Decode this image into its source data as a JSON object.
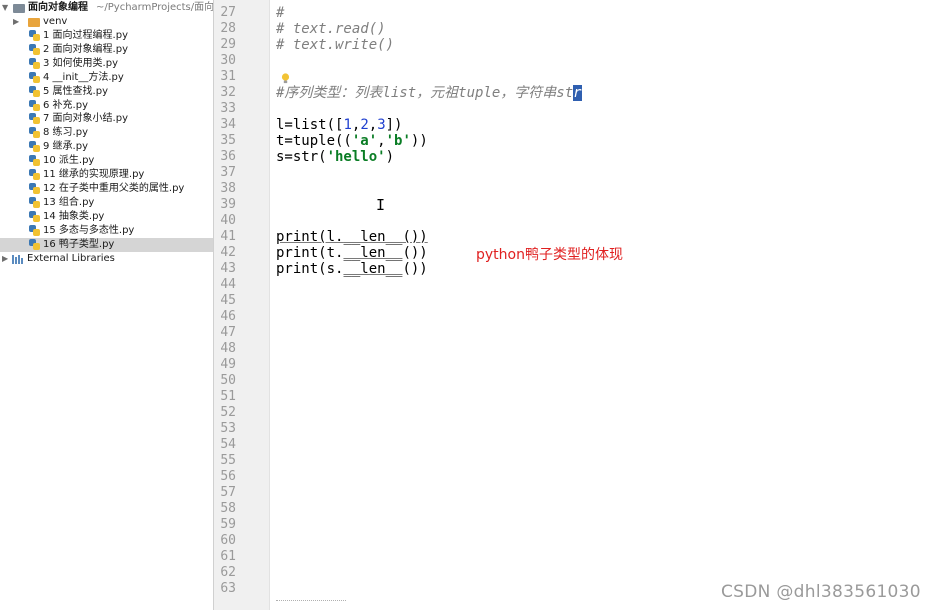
{
  "project": {
    "root_label": "面向对象编程",
    "root_path": "~/PycharmProjects/面向",
    "venv_label": "venv",
    "files": [
      "1 面向过程编程.py",
      "2 面向对象编程.py",
      "3 如何使用类.py",
      "4 __init__方法.py",
      "5 属性查找.py",
      "6 补充.py",
      "7 面向对象小结.py",
      "8 练习.py",
      "9 继承.py",
      "10 派生.py",
      "11 继承的实现原理.py",
      "12 在子类中重用父类的属性.py",
      "13 组合.py",
      "14 抽象类.py",
      "15 多态与多态性.py",
      "16 鸭子类型.py"
    ],
    "selected_file": "16 鸭子类型.py",
    "external_libraries": "External Libraries"
  },
  "editor": {
    "line_numbers": [
      "27",
      "28",
      "29",
      "30",
      "31",
      "32",
      "33",
      "34",
      "35",
      "36",
      "37",
      "38",
      "39",
      "40",
      "41",
      "42",
      "43",
      "44",
      "45",
      "46",
      "47",
      "48",
      "49",
      "50",
      "51",
      "52",
      "53",
      "54",
      "55",
      "56",
      "57",
      "58",
      "59",
      "60",
      "61",
      "62",
      "63"
    ],
    "line27": "#",
    "line28": "# text.read()",
    "line29": "# text.write()",
    "line32_text": "#序列类型：列表list，元祖tuple，字符串st",
    "line32_caret": "r",
    "l34_a": "l=list([",
    "l34_n1": "1",
    "l34_c1": ",",
    "l34_n2": "2",
    "l34_c2": ",",
    "l34_n3": "3",
    "l34_b": "])",
    "l35_a": "t=tuple((",
    "l35_s1": "'a'",
    "l35_c": ",",
    "l35_s2": "'b'",
    "l35_b": "))",
    "l36_a": "s=str(",
    "l36_s": "'hello'",
    "l36_b": ")",
    "l41_a": "print(l.",
    "l41_u": "__len__",
    "l41_b": "())",
    "l42_a": "print(t.",
    "l42_u": "__len__",
    "l42_b": "())",
    "l43_a": "print(s.",
    "l43_u": "__len__",
    "l43_b": "())"
  },
  "annotation": "python鸭子类型的体现",
  "watermark": "CSDN @dhl383561030",
  "colors": {
    "keyword_number": "#1f3fcf",
    "string": "#0a7d25",
    "comment": "#7f7f7f",
    "annotation": "#e02020",
    "selection": "#d5d5d5"
  }
}
